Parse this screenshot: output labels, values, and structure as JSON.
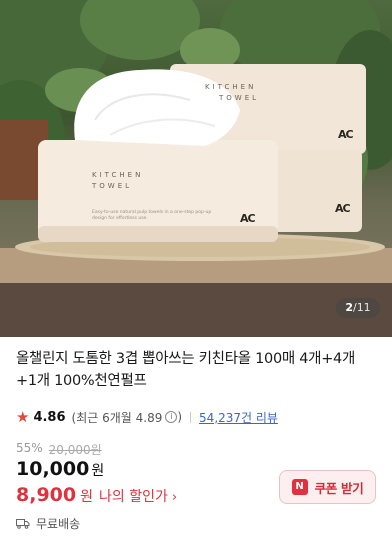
{
  "product_image": {
    "box_brand_line1": "KITCHEN",
    "box_brand_line2": "TOWEL",
    "box_logo": "AC",
    "box_description": "Easy-to-use natural pulp towels in a one-step pop-up design for effortless use.",
    "counter_current": "2",
    "counter_separator": "/",
    "counter_total": "11"
  },
  "product": {
    "title": "올챌린지 도톰한 3겹 뽑아쓰는 키친타올 100매 4개+4개 +1개 100%천연펄프",
    "rating_star": "★",
    "rating": "4.86",
    "recent_rating": "(최근 6개월 4.89",
    "info_icon": "i",
    "recent_close": ")",
    "review_count": "54,237건 리뷰",
    "discount_percent": "55%",
    "original_price": "20,000원",
    "price": "10,000",
    "price_unit": "원",
    "my_price": "8,900",
    "my_price_unit": "원",
    "my_price_label": "나의 할인가",
    "my_price_chevron": "›"
  },
  "coupon": {
    "badge": "N",
    "label": "쿠폰 받기"
  },
  "shipping": {
    "label": "무료배송"
  },
  "colors": {
    "accent_red": "#e0313f",
    "link_blue": "#3a66c4",
    "star": "#e9453a"
  }
}
